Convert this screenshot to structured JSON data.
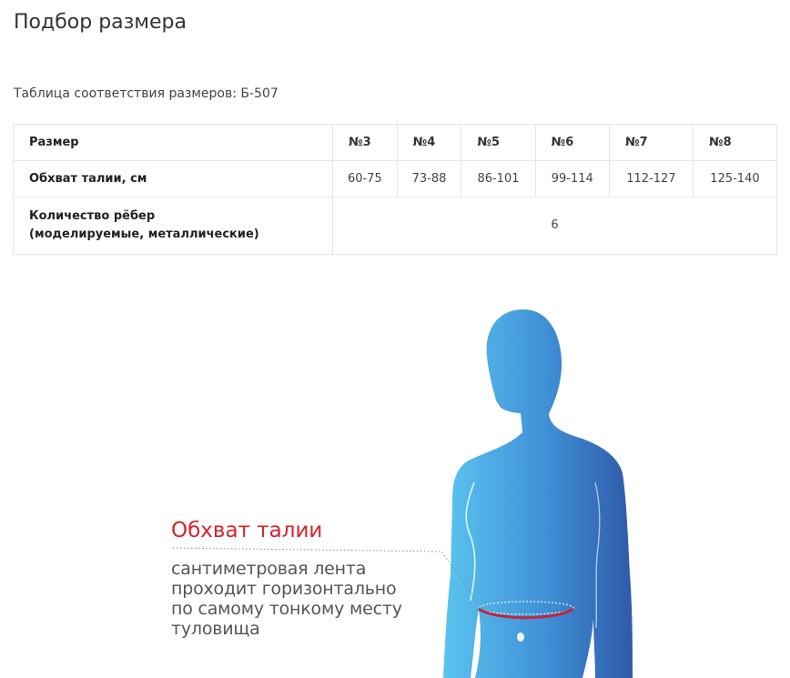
{
  "page": {
    "title": "Подбор размера"
  },
  "table": {
    "caption": "Таблица соответствия размеров: Б-507",
    "header_label": "Размер",
    "sizes": [
      "№3",
      "№4",
      "№5",
      "№6",
      "№7",
      "№8"
    ],
    "waist_label": "Обхват талии, см",
    "waist_values": [
      "60-75",
      "73-88",
      "86-101",
      "99-114",
      "112-127",
      "125-140"
    ],
    "ribs_label_line1": "Количество рёбер",
    "ribs_label_line2": "(моделируемые, металлические)",
    "ribs_value": "6"
  },
  "illustration": {
    "title": "Обхват талии",
    "lines": [
      "сантиметровая лента",
      "проходит горизонтально",
      "по самому тонкому месту",
      "туловища"
    ],
    "colors": {
      "body_light": "#5bc4f0",
      "body_dark": "#2f5aa8",
      "tape": "#c8233a",
      "title": "#d8232a"
    }
  }
}
